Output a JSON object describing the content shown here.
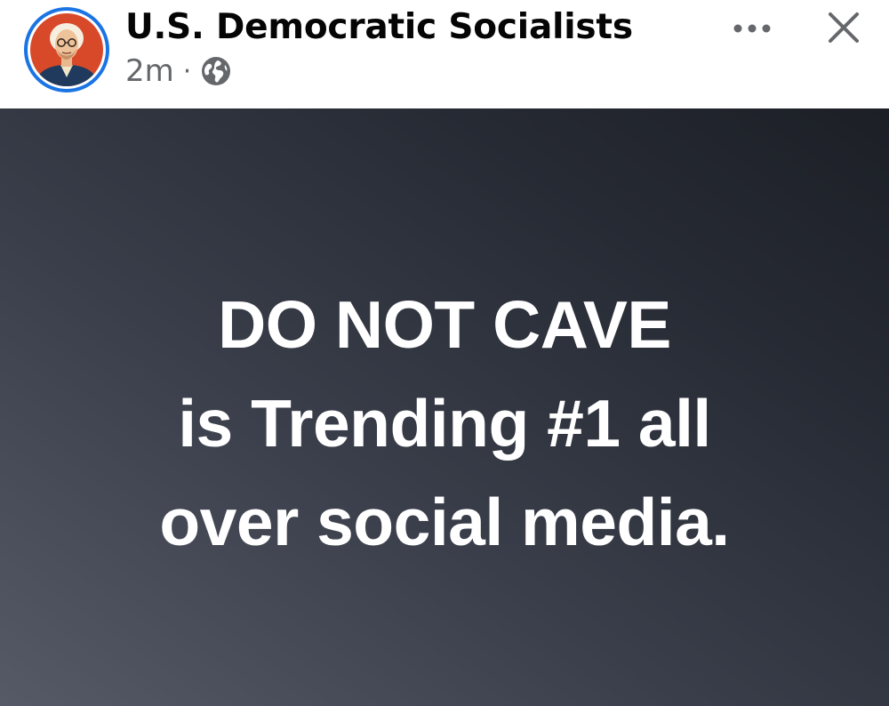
{
  "header": {
    "page_name": "U.S. Democratic Socialists",
    "timestamp": "2m",
    "separator": "·",
    "privacy_icon": "globe-icon",
    "more_icon": "more-options-icon",
    "close_icon": "close-icon",
    "avatar_ring_color": "#1b74e4"
  },
  "post": {
    "text_lines": [
      "DO NOT CAVE",
      "is Trending #1 all",
      "over social media."
    ],
    "text_color": "#ffffff",
    "background_colors": [
      "#555a66",
      "#3a3e4a",
      "#262a33",
      "#1c1f26"
    ]
  }
}
